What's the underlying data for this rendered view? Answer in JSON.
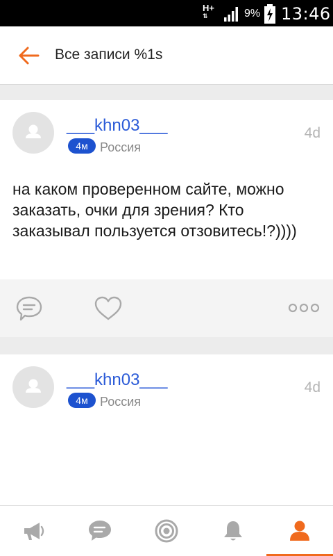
{
  "status_bar": {
    "network": "H+",
    "battery_percent": "9%",
    "clock": "13:46"
  },
  "app_bar": {
    "back_icon": "arrow-left-icon",
    "title": "Все записи %1s"
  },
  "posts": [
    {
      "author": "___khn03___",
      "badge": "4м",
      "country": "Россия",
      "time": "4d",
      "text": "на каком проверенном сайте, можно заказать, очки для зрения? Кто заказывал пользуется отзовитесь!?))))",
      "actions": [
        "comment-icon",
        "heart-icon",
        "more-dots-icon"
      ]
    },
    {
      "author": "___khn03___",
      "badge": "4м",
      "country": "Россия",
      "time": "4d"
    }
  ],
  "bottom_nav": {
    "items": [
      "megaphone-icon",
      "chat-icon",
      "target-icon",
      "bell-icon",
      "profile-icon"
    ],
    "active_index": 4
  },
  "colors": {
    "accent": "#f06a1d",
    "username": "#2a5ad7",
    "badge": "#1d52cf",
    "icon_gray": "#a9a9a9"
  }
}
